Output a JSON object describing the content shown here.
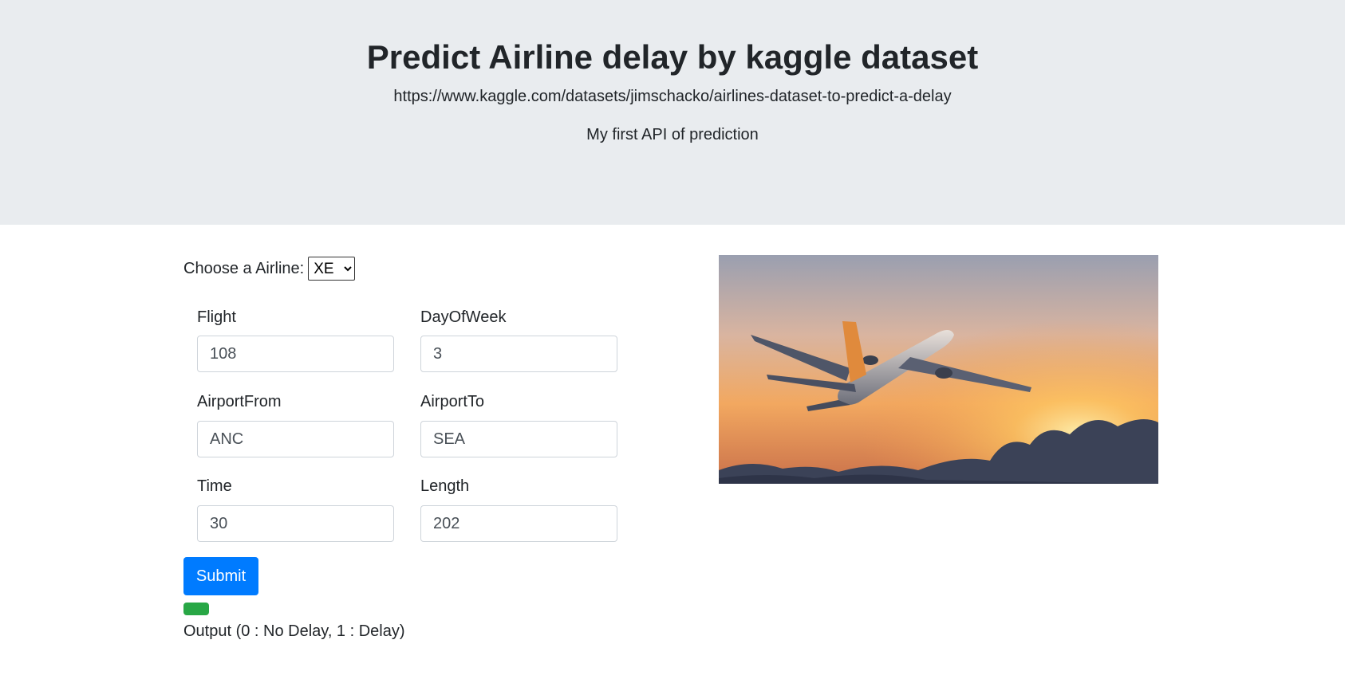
{
  "header": {
    "title": "Predict Airline delay by kaggle dataset",
    "url": "https://www.kaggle.com/datasets/jimschacko/airlines-dataset-to-predict-a-delay",
    "subtitle": "My first API of prediction"
  },
  "form": {
    "airline_label": "Choose a Airline:",
    "airline_selected": "XE",
    "fields": {
      "flight": {
        "label": "Flight",
        "value": "108"
      },
      "day_of_week": {
        "label": "DayOfWeek",
        "value": "3"
      },
      "airport_from": {
        "label": "AirportFrom",
        "value": "ANC"
      },
      "airport_to": {
        "label": "AirportTo",
        "value": "SEA"
      },
      "time": {
        "label": "Time",
        "value": "30"
      },
      "length": {
        "label": "Length",
        "value": "202"
      }
    },
    "submit_label": "Submit",
    "output_note": "Output (0 : No Delay, 1 : Delay)"
  },
  "colors": {
    "jumbotron_bg": "#e9ecef",
    "primary": "#007bff",
    "success": "#28a745"
  },
  "image": {
    "semantic": "airplane-sunset-photo"
  }
}
